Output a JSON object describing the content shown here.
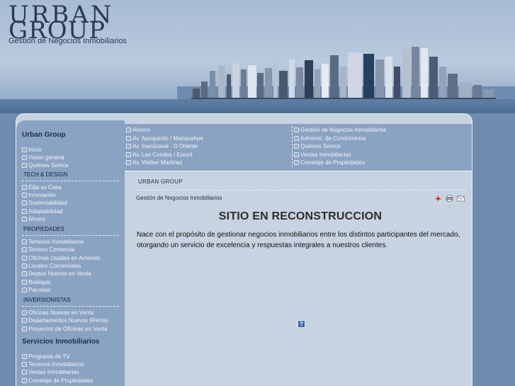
{
  "header": {
    "logo_line1": "URBAN",
    "logo_line2": "GROUP",
    "logo_subtitle": "Gestión de Negocios Inmobiliarios"
  },
  "sidebar": {
    "section1_title": "Urban Group",
    "section1_items": [
      "Inicio",
      "Visión general",
      "Quiénes Somos"
    ],
    "cat_tech": "TECH & DESIGN",
    "tech_items": [
      "Elija su Casa",
      "Innovación",
      "Sustentabilidad",
      "Adaptabilidad",
      "Ahorro"
    ],
    "cat_props": "PROPIEDADES",
    "props_items": [
      "Terrenos Inmobiliarios",
      "Terreno Comercial",
      "Oficinas Usadas en Arriendo",
      "Locales Comerciales",
      "Deptos Nuevos en Venta",
      "Bodegas",
      "Parcelas"
    ],
    "cat_inv": "INVERSIONISTAS",
    "inv_items": [
      "Oficinas Nuevas en Venta",
      "Departamentos Nuevos (Renta)",
      "Proyectos de Oficinas en Venta"
    ],
    "section2_title": "Servicios Inmobiliarios",
    "section2_items": [
      "Programa de TV",
      "Terrenos Inmobiliarios",
      "Ventas Inmobiliarias",
      "Corretaje de Propiedades"
    ]
  },
  "topnav": {
    "left": [
      "Ahorro",
      "Av. Apoquindo / Manquehue",
      "Av. Irarrázaval - D Oriente",
      "Av. Las Condes / Estoril",
      "Av. Walker Martinez"
    ],
    "right": [
      "Gestión de Negocios Inmobiliarios",
      "Administ. de Condominios",
      "Quiénes Somos",
      "Ventas Inmobiliarias",
      "Corretaje de Propiedades"
    ]
  },
  "content": {
    "breadcrumb": "URBAN GROUP",
    "subtitle": "Gestión de Negocios Inmobiliarios",
    "headline": "SITIO EN RECONSTRUCCION",
    "body": "Nace con el propósito de gestionar negocios inmobiliarios entre los distintos participantes del mercado, otorgando un servicio de excelencia y respuestas integrales a nuestros clientes.",
    "tools": [
      "pdf-icon",
      "print-icon",
      "email-icon"
    ],
    "help_icon_label": "?"
  }
}
